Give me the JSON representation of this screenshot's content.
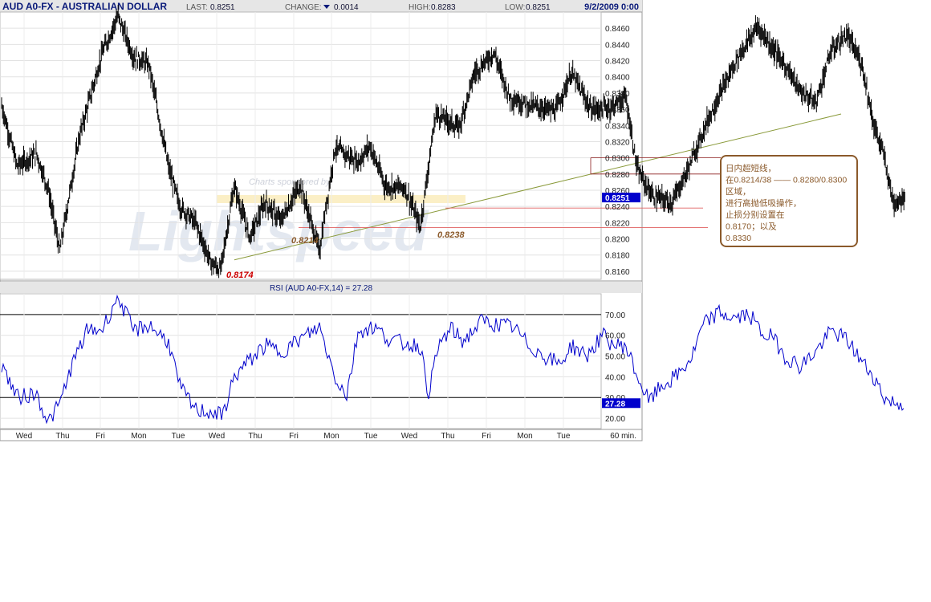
{
  "header": {
    "symbol_title": "AUD A0-FX - AUSTRALIAN DOLLAR",
    "last_label": "LAST:",
    "last_value": "0.8251",
    "change_label": "CHANGE:",
    "change_value": "0.0014",
    "high_label": "HIGH:",
    "high_value": "0.8283",
    "low_label": "LOW:",
    "low_value": "0.8251",
    "datetime": "9/2/2009 0:00"
  },
  "colors": {
    "title": "#0a1a7a",
    "header_bg": "#e6e6e6",
    "price": "#000000",
    "rsi_line": "#0000cc",
    "trendline": "#8a9a3a",
    "label_brown": "#8b5a2b",
    "label_red": "#cc0000",
    "callout_border": "#8b5a2b",
    "last_badge": "#0000cc",
    "ref_lines": "#e06060"
  },
  "watermark": {
    "sponsor_text": "Charts sponsored by:",
    "logo_text": "Lightspeed"
  },
  "annotations": {
    "low_1": "0.8174",
    "low_2": "0.8214",
    "low_3": "0.8238",
    "callout_lines": [
      "日内超短线，",
      "在0.8214/38 —— 0.8280/0.8300",
      "区域，",
      "进行高抛低吸操作，",
      "止损分别设置在",
      "0.8170；以及",
      "0.8330"
    ]
  },
  "rsi_title": "RSI (AUD A0-FX,14) = 27.28",
  "timeframe": "60 min.",
  "chart_data": [
    {
      "type": "candlestick",
      "title": "AUD A0-FX - AUSTRALIAN DOLLAR",
      "ylim": [
        0.815,
        0.848
      ],
      "y_ticks": [
        "0.8460",
        "0.8440",
        "0.8420",
        "0.8400",
        "0.8380",
        "0.8360",
        "0.8340",
        "0.8320",
        "0.8300",
        "0.8280",
        "0.8260",
        "0.8240",
        "0.8220",
        "0.8200",
        "0.8180",
        "0.8160"
      ],
      "last_value": "0.8251",
      "x_ticks": [
        "Wed",
        "Thu",
        "Fri",
        "Mon",
        "Tue",
        "Wed",
        "Thu",
        "Fri",
        "Mon",
        "Tue",
        "Wed",
        "Thu",
        "Fri",
        "Mon",
        "Tue"
      ],
      "path": [
        [
          0,
          0.8365
        ],
        [
          0.4,
          0.829
        ],
        [
          0.9,
          0.8305
        ],
        [
          1.2,
          0.8262
        ],
        [
          1.5,
          0.8185
        ],
        [
          2.0,
          0.8325
        ],
        [
          2.6,
          0.843
        ],
        [
          3.0,
          0.8475
        ],
        [
          3.4,
          0.8425
        ],
        [
          3.8,
          0.8415
        ],
        [
          4.3,
          0.829
        ],
        [
          4.6,
          0.824
        ],
        [
          5.0,
          0.822
        ],
        [
          5.4,
          0.817
        ],
        [
          5.65,
          0.8162
        ],
        [
          6.0,
          0.8265
        ],
        [
          6.4,
          0.8202
        ],
        [
          6.8,
          0.8245
        ],
        [
          7.2,
          0.8222
        ],
        [
          7.7,
          0.8267
        ],
        [
          8.2,
          0.8185
        ],
        [
          8.6,
          0.8312
        ],
        [
          9.2,
          0.8295
        ],
        [
          9.5,
          0.8315
        ],
        [
          9.9,
          0.8265
        ],
        [
          10.4,
          0.8263
        ],
        [
          10.8,
          0.8215
        ],
        [
          11.2,
          0.8355
        ],
        [
          11.8,
          0.8337
        ],
        [
          12.2,
          0.8405
        ],
        [
          12.7,
          0.843
        ],
        [
          13.1,
          0.8375
        ],
        [
          13.6,
          0.8365
        ],
        [
          14.3,
          0.8358
        ],
        [
          14.7,
          0.8405
        ],
        [
          15.2,
          0.836
        ],
        [
          15.7,
          0.8362
        ],
        [
          16.1,
          0.8375
        ],
        [
          16.4,
          0.8285
        ],
        [
          16.8,
          0.8252
        ],
        [
          17.3,
          0.8245
        ],
        [
          17.7,
          0.8285
        ],
        [
          18.2,
          0.8345
        ],
        [
          18.6,
          0.8385
        ],
        [
          19.0,
          0.8425
        ],
        [
          19.5,
          0.8462
        ],
        [
          19.9,
          0.8435
        ],
        [
          20.3,
          0.8408
        ],
        [
          20.6,
          0.8382
        ],
        [
          21.0,
          0.8368
        ],
        [
          21.4,
          0.8432
        ],
        [
          21.8,
          0.8452
        ],
        [
          22.2,
          0.8415
        ],
        [
          22.5,
          0.834
        ],
        [
          22.75,
          0.8305
        ],
        [
          23.0,
          0.8245
        ],
        [
          23.3,
          0.8252
        ]
      ]
    },
    {
      "type": "line",
      "title": "RSI (AUD A0-FX,14) = 27.28",
      "series": [
        {
          "name": "RSI (AUD A0-FX,14)",
          "last": 27.28
        }
      ],
      "ylim": [
        15,
        80
      ],
      "y_ticks": [
        "70.00",
        "60.00",
        "50.00",
        "40.00",
        "30.00",
        "20.00"
      ],
      "reference_lines": [
        30,
        70
      ],
      "x_ticks": [
        "Wed",
        "Thu",
        "Fri",
        "Mon",
        "Tue",
        "Wed",
        "Thu",
        "Fri",
        "Mon",
        "Tue",
        "Wed",
        "Thu",
        "Fri",
        "Mon",
        "Tue"
      ],
      "values": [
        [
          0,
          46
        ],
        [
          0.4,
          30
        ],
        [
          0.9,
          32
        ],
        [
          1.2,
          18
        ],
        [
          1.5,
          27
        ],
        [
          1.8,
          45
        ],
        [
          2.2,
          62
        ],
        [
          2.6,
          63
        ],
        [
          3.0,
          79
        ],
        [
          3.4,
          62
        ],
        [
          3.8,
          65
        ],
        [
          4.3,
          57
        ],
        [
          4.6,
          35
        ],
        [
          5.0,
          24
        ],
        [
          5.4,
          23
        ],
        [
          5.7,
          21
        ],
        [
          6.0,
          40
        ],
        [
          6.4,
          48
        ],
        [
          6.8,
          55
        ],
        [
          7.2,
          52
        ],
        [
          7.7,
          58
        ],
        [
          8.2,
          64
        ],
        [
          8.6,
          40
        ],
        [
          8.9,
          31
        ],
        [
          9.2,
          62
        ],
        [
          9.6,
          64
        ],
        [
          10.0,
          58
        ],
        [
          10.4,
          56
        ],
        [
          10.8,
          55
        ],
        [
          11.0,
          32
        ],
        [
          11.3,
          56
        ],
        [
          11.6,
          63
        ],
        [
          11.9,
          57
        ],
        [
          12.4,
          67
        ],
        [
          12.8,
          65
        ],
        [
          13.2,
          64
        ],
        [
          13.6,
          55
        ],
        [
          14.0,
          50
        ],
        [
          14.4,
          46
        ],
        [
          14.7,
          55
        ],
        [
          15.1,
          50
        ],
        [
          15.5,
          60
        ],
        [
          15.8,
          55
        ],
        [
          16.1,
          55
        ],
        [
          16.4,
          40
        ],
        [
          16.7,
          28
        ],
        [
          17.0,
          35
        ],
        [
          17.4,
          40
        ],
        [
          17.8,
          49
        ],
        [
          18.1,
          65
        ],
        [
          18.5,
          71
        ],
        [
          18.9,
          68
        ],
        [
          19.3,
          70
        ],
        [
          19.6,
          61
        ],
        [
          19.9,
          59
        ],
        [
          20.2,
          50
        ],
        [
          20.6,
          45
        ],
        [
          21.0,
          52
        ],
        [
          21.4,
          62
        ],
        [
          21.8,
          58
        ],
        [
          22.2,
          47
        ],
        [
          22.5,
          40
        ],
        [
          22.8,
          29
        ],
        [
          23.1,
          27
        ],
        [
          23.3,
          27.28
        ]
      ]
    }
  ]
}
